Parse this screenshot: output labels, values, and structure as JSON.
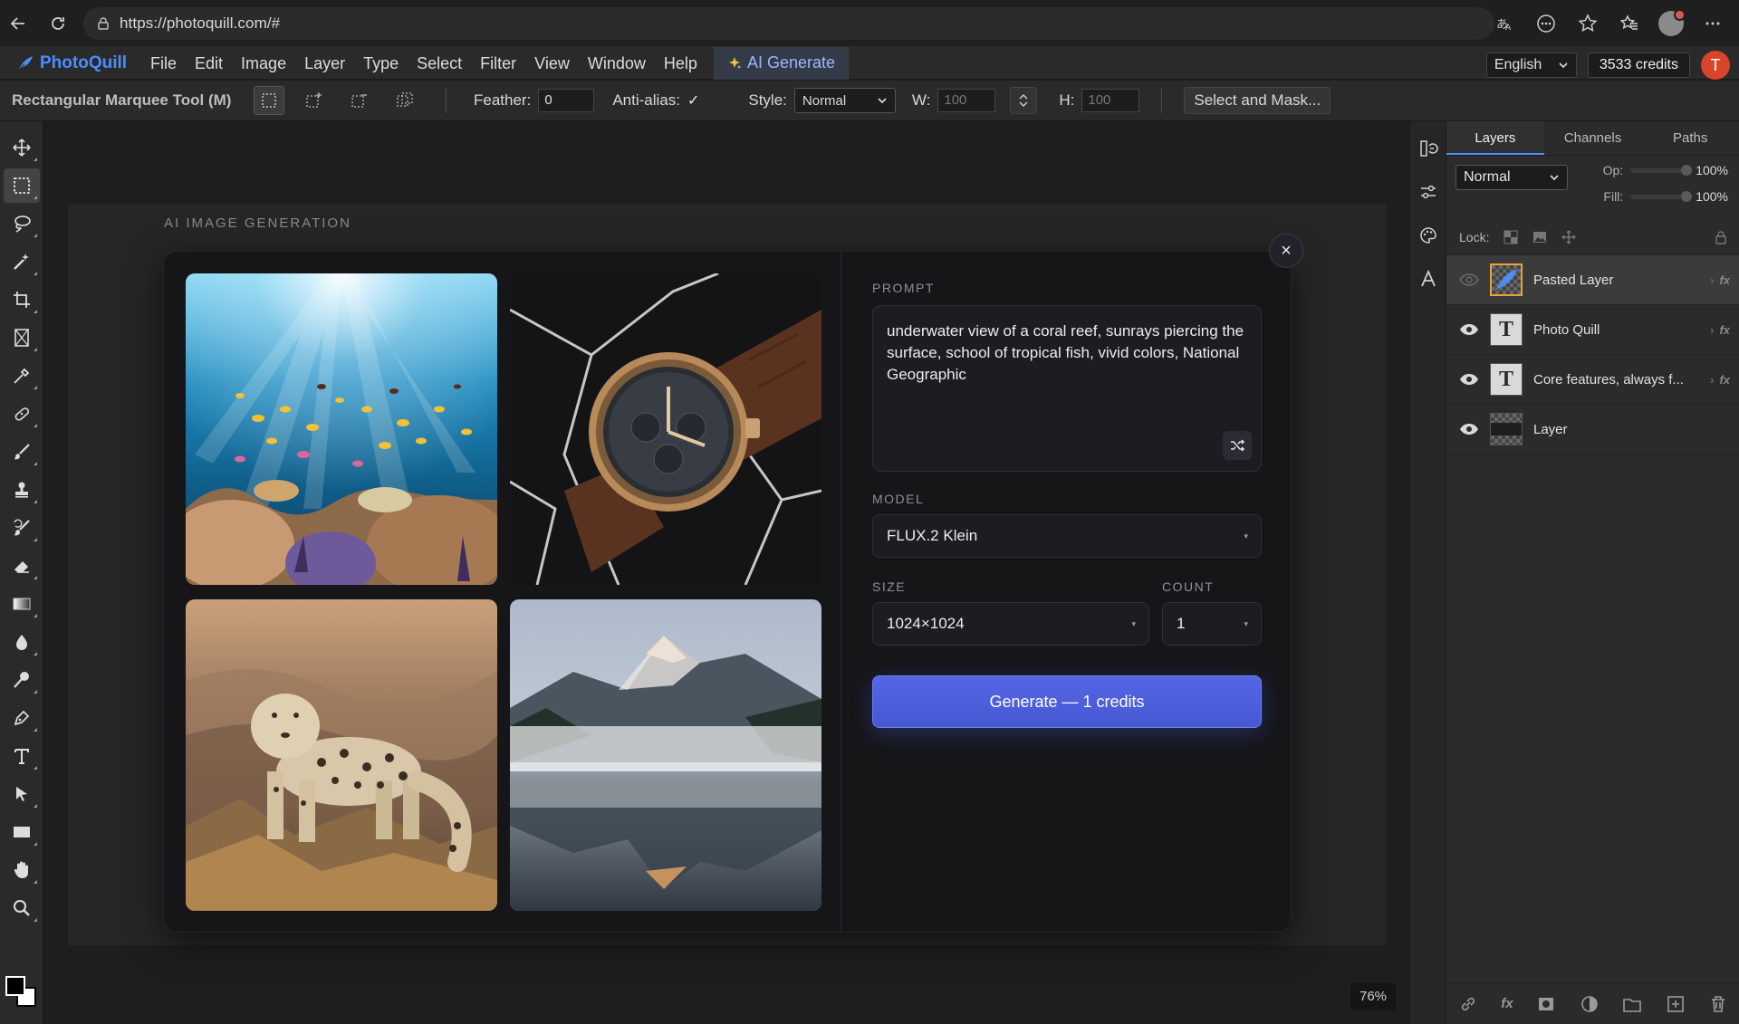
{
  "browser": {
    "url": "https://photoquill.com/#"
  },
  "app": {
    "name": "PhotoQuill",
    "menus": [
      "File",
      "Edit",
      "Image",
      "Layer",
      "Type",
      "Select",
      "Filter",
      "View",
      "Window",
      "Help"
    ],
    "ai_menu_label": "AI Generate",
    "language": "English",
    "credits": "3533 credits",
    "avatar_initial": "T",
    "accent_color": "#4a8dff"
  },
  "options_bar": {
    "tool_name": "Rectangular Marquee Tool (M)",
    "feather_label": "Feather:",
    "feather_value": "0",
    "antialias_label": "Anti-alias:",
    "antialias_checked": "✓",
    "style_label": "Style:",
    "style_value": "Normal",
    "width_label": "W:",
    "width_value": "100",
    "height_label": "H:",
    "height_value": "100",
    "select_mask_label": "Select and Mask..."
  },
  "toolbar": {
    "tools": [
      "move-tool",
      "marquee-tool",
      "lasso-tool",
      "magic-wand-tool",
      "crop-tool",
      "frame-tool",
      "eyedropper-tool",
      "healing-tool",
      "brush-tool",
      "clone-stamp-tool",
      "history-brush-tool",
      "eraser-tool",
      "gradient-tool",
      "blur-tool",
      "dodge-tool",
      "pen-tool",
      "type-tool",
      "path-selection-tool",
      "rectangle-tool",
      "hand-tool",
      "zoom-tool"
    ],
    "active_tool": "marquee-tool"
  },
  "canvas": {
    "section_title": "AI IMAGE GENERATION",
    "zoom": "76%"
  },
  "ai_dialog": {
    "close_label": "×",
    "gallery": [
      {
        "name": "coral-reef-image",
        "subject": "underwater coral reef with tropical fish"
      },
      {
        "name": "wristwatch-image",
        "subject": "bronze wristwatch on dark marble"
      },
      {
        "name": "snow-leopard-image",
        "subject": "snow leopard on rocks"
      },
      {
        "name": "mountain-lake-image",
        "subject": "snowy mountain reflected in misty lake"
      }
    ],
    "prompt_label": "PROMPT",
    "prompt_text": "underwater view of a coral reef, sunrays piercing the surface, school of tropical fish, vivid colors, National Geographic",
    "model_label": "MODEL",
    "model_value": "FLUX.2 Klein",
    "size_label": "SIZE",
    "size_value": "1024×1024",
    "count_label": "COUNT",
    "count_value": "1",
    "generate_label": "Generate — 1 credits",
    "generate_color": "#4f62e0"
  },
  "layers_panel": {
    "tabs": [
      "Layers",
      "Channels",
      "Paths"
    ],
    "blend_mode": "Normal",
    "opacity_label": "Op:",
    "opacity_value": "100%",
    "fill_label": "Fill:",
    "fill_value": "100%",
    "lock_label": "Lock:",
    "layers": [
      {
        "name": "Pasted Layer",
        "type": "image",
        "visible": false,
        "selected": true,
        "fx": "fx"
      },
      {
        "name": "Photo Quill",
        "type": "text",
        "visible": true,
        "selected": false,
        "fx": "fx"
      },
      {
        "name": "Core features, always f...",
        "type": "text",
        "visible": true,
        "selected": false,
        "fx": "fx"
      },
      {
        "name": "Layer",
        "type": "raster",
        "visible": true,
        "selected": false,
        "fx": ""
      }
    ],
    "text_thumb_glyph": "T",
    "footer_fx": "fx"
  }
}
